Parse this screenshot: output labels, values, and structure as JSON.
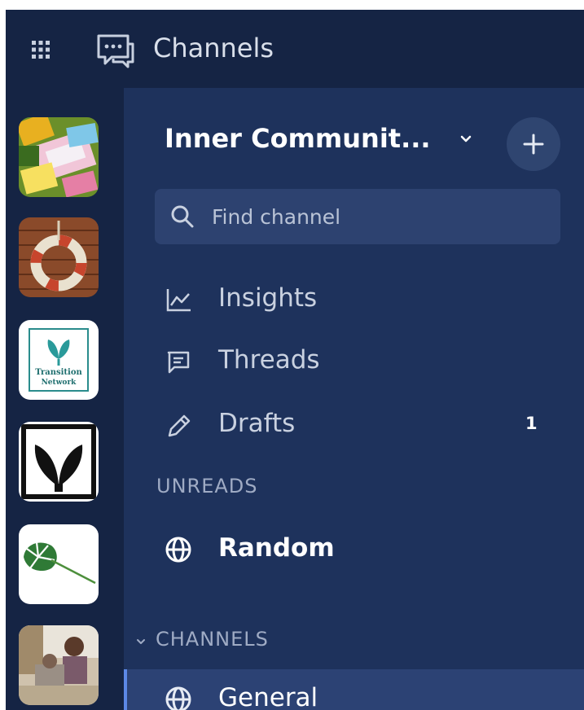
{
  "topbar": {
    "title": "Channels",
    "grid_icon": "grid-icon",
    "channels_icon": "chat-icon"
  },
  "team": {
    "name": "Inner Communit...",
    "add_label": "+"
  },
  "search": {
    "placeholder": "Find channel"
  },
  "nav": [
    {
      "label": "Insights",
      "icon": "insights-chart-icon"
    },
    {
      "label": "Threads",
      "icon": "threads-icon"
    },
    {
      "label": "Drafts",
      "icon": "pencil-icon",
      "badge": "1"
    }
  ],
  "unreads": {
    "heading": "UNREADS",
    "items": [
      {
        "label": "Random",
        "icon": "globe-icon"
      }
    ]
  },
  "channels": {
    "heading": "CHANNELS",
    "items": [
      {
        "label": "General",
        "icon": "globe-icon",
        "active": true
      }
    ]
  },
  "colors": {
    "topbar": "#152444",
    "sidebar": "#1e325c",
    "accent": "#5c88e6"
  }
}
